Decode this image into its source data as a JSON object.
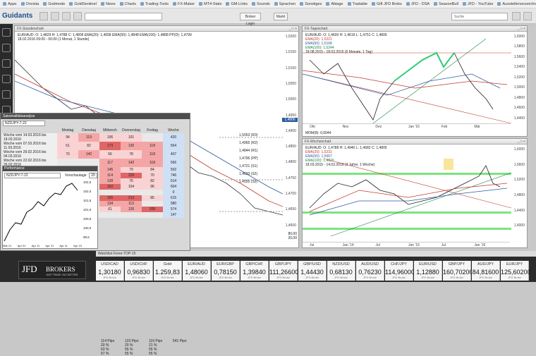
{
  "bookmarks": [
    "Apps",
    "Onvista",
    "Godmode",
    "GoldSentinel",
    "Nixes",
    "Charts",
    "Trading-Tools",
    "FX-Maker",
    "MT4-Stats",
    "GM-Links",
    "Sounds",
    "Sprachen",
    "Sonstiges",
    "Ablage",
    "Tradable",
    "Gift JFD Broks",
    "JFD - DSA",
    "SeasonBull",
    "JFD - YouTube",
    "Ausstellerverzeichnis"
  ],
  "app": {
    "logo": "Guidants",
    "search_placeholder": "Suche",
    "btn_login": "Broker Login",
    "btn_markt": "Markt"
  },
  "win1": {
    "title": "FX-Stundenchart",
    "legend": [
      "EUR/AUD: O: 1,4829 H: 1,4788 C: 1,4806",
      "EMA(20): 1,4658",
      "EMA(50): 1,4848",
      "EMA(100): 1,4888",
      "PP(D): 1,4799"
    ],
    "subtitle": "18.02.2016 09:00 - 00:00 (1 Monat, 1 Stunde)",
    "prices": [
      "1,5200",
      "1,5150",
      "1,5100",
      "1,5050",
      "1,5000",
      "1,4950",
      "1,4900",
      "1,4850",
      "1,4800",
      "1,4750",
      "1,4700",
      "1,4650",
      "1,4600"
    ],
    "levels": [
      "1,5053 (R3)",
      "1,4965 (R2)",
      "1,4844 (R1)",
      "1,4796 (PP)",
      "1,4721 (S1)",
      "1,4633 (S2)",
      "1,4555 (S3)"
    ],
    "sub_values": [
      "80,00",
      "20,00"
    ]
  },
  "win2": {
    "title": "FX-Tageschart",
    "legend": [
      "EUR/AUD: O: 1,4600 H: 1,4619 L: 1,4751 C: 1,4806",
      "EMA(20): 1,5221",
      "EMA(50): 1,5168",
      "EMA(100): 1,5244",
      "18.08.2015 - 18.03.2016 (6 Monate, 1 Tag)"
    ],
    "prices": [
      "1,6000",
      "1,5800",
      "1,5600",
      "1,5400",
      "1,5200",
      "1,5000",
      "1,4800",
      "1,4600",
      "1,4400"
    ],
    "xlabels": [
      "Okt",
      "Nov",
      "Dez",
      "Jan '16",
      "Feb",
      "Mär"
    ],
    "sub": "MOM(8): 0,0044"
  },
  "win3": {
    "title": "FX-Wochenchart",
    "legend": [
      "EUR/AUD: O: 1,4788 H: 1,4940 L: 1,4682 C: 1,4805",
      "EMA(20): 1,5231",
      "EMA(50): 1,5067",
      "EMA(100): 1,4820",
      "18.03.2015 - 14.03.2016 (3 Jahre, 1 Woche)"
    ],
    "prices": [
      "1,6000",
      "1,5600",
      "1,5200",
      "1,4800",
      "1,4400",
      "1,4000"
    ],
    "xlabels": [
      "Jul",
      "Jan '14",
      "Jul",
      "Jan '15",
      "Jul",
      "Jan '16"
    ]
  },
  "seasonality": {
    "title": "Saisonalitätsanalyse",
    "symbol": "NZDJPY-7-22",
    "months": [
      "Montag",
      "Dienstag",
      "Mittwoch",
      "Donnerstag",
      "Freitag",
      "Woche"
    ],
    "rows": [
      {
        "label": "Woche vom 14.03.2016 bis 18.03.2016",
        "vals": [
          "94",
          "119",
          "106",
          "101",
          "",
          "420"
        ]
      },
      {
        "label": "Woche vom 07.03.2016 bis 11.03.2016",
        "vals": [
          "61",
          "82",
          "173",
          "130",
          "118",
          "564"
        ]
      },
      {
        "label": "Woche vom 29.02.2016 bis 04.03.2016",
        "vals": [
          "70",
          "142",
          "56",
          "78",
          "118",
          "407"
        ]
      },
      {
        "label": "Woche vom 22.02.2016 bis 26.02.2016",
        "vals": [
          "",
          "",
          "117",
          "142",
          "118",
          "566"
        ]
      },
      {
        "label": "",
        "vals": [
          "",
          "",
          "145",
          "79",
          "84",
          "502"
        ]
      },
      {
        "label": "",
        "vals": [
          "",
          "",
          "114",
          "229",
          "70",
          "746"
        ]
      },
      {
        "label": "",
        "vals": [
          "",
          "",
          "128",
          "76",
          "82",
          "614"
        ]
      },
      {
        "label": "",
        "vals": [
          "",
          "",
          "162",
          "104",
          "96",
          "604"
        ]
      },
      {
        "label": "",
        "vals": [
          "",
          "",
          "",
          "",
          "",
          "0"
        ]
      },
      {
        "label": "",
        "vals": [
          "",
          "",
          "165",
          "213",
          "85",
          "615"
        ]
      },
      {
        "label": "",
        "vals": [
          "",
          "",
          "134",
          "113",
          "",
          "580"
        ]
      },
      {
        "label": "",
        "vals": [
          "",
          "",
          "61",
          "126",
          "209",
          "574"
        ]
      },
      {
        "label": "",
        "vals": [
          "",
          "",
          "",
          "",
          "",
          "147"
        ]
      }
    ],
    "summary": [
      [
        "114 Pips",
        "123 Pips",
        "116 Pips",
        "541 Pips"
      ],
      [
        "20 %",
        "20 %",
        "21 %",
        ""
      ],
      [
        "63 %",
        "55 %",
        "55 %",
        ""
      ],
      [
        "57 %",
        "55 %",
        "55 %",
        ""
      ]
    ],
    "perf_title": "Performance",
    "perf_symbol": "NZDJPY-7-22",
    "perf_label": "Vorschautage",
    "perf_days": "20",
    "perf_y": [
      "102,5",
      "102,0",
      "101,5",
      "101,0",
      "100,5",
      "100,0",
      "99,5"
    ],
    "perf_x": [
      "Mär 21",
      "Apr 01",
      "Apr 11",
      "Apr 21",
      "Apr 11",
      "Apr 19"
    ]
  },
  "quotes": {
    "header": "Watchlist Forex-TOP-15",
    "broker": "JFD",
    "broker_sub": "BROKERS",
    "broker_tag": "JUST TRADE. BUT BETTER.",
    "items": [
      {
        "name": "USD/CAD",
        "price": "1,30180"
      },
      {
        "name": "USD/CHF",
        "price": "0,96830"
      },
      {
        "name": "Gold",
        "price": "1.259,83"
      },
      {
        "name": "EUR/AUD",
        "price": "1,48060"
      },
      {
        "name": "EUR/GBP",
        "price": "0,78150"
      },
      {
        "name": "GBP/CHF",
        "price": "1,39840"
      },
      {
        "name": "GBP/JPY",
        "price": "111,26600"
      },
      {
        "name": "GBP/USD",
        "price": "1,44430"
      },
      {
        "name": "NZD/USD",
        "price": "0,68130"
      },
      {
        "name": "AUD/USD",
        "price": "0,76230"
      },
      {
        "name": "CHF/JPY",
        "price": "114,96000"
      },
      {
        "name": "EUR/USD",
        "price": "1,12880"
      },
      {
        "name": "GBP/JPY",
        "price": "160,70200"
      },
      {
        "name": "AUD/JPY",
        "price": "84,81600"
      },
      {
        "name": "EUR/JPY",
        "price": "125,60200"
      }
    ],
    "tick": "JFD Broke"
  }
}
